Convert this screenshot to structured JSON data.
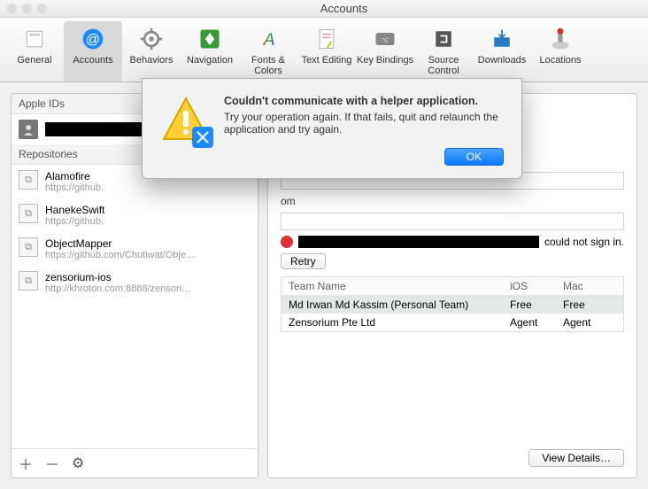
{
  "window": {
    "title": "Accounts"
  },
  "toolbar": {
    "items": [
      {
        "label": "General"
      },
      {
        "label": "Accounts"
      },
      {
        "label": "Behaviors"
      },
      {
        "label": "Navigation"
      },
      {
        "label": "Fonts & Colors"
      },
      {
        "label": "Text Editing"
      },
      {
        "label": "Key Bindings"
      },
      {
        "label": "Source Control"
      },
      {
        "label": "Downloads"
      },
      {
        "label": "Locations"
      }
    ]
  },
  "left": {
    "appleids_header": "Apple IDs",
    "repos_header": "Repositories",
    "repos": [
      {
        "name": "Alamofire",
        "sub": "https://github."
      },
      {
        "name": "HanekeSwift",
        "sub": "https://github."
      },
      {
        "name": "ObjectMapper",
        "sub": "https://github.com/Chutiwat/Obje…"
      },
      {
        "name": "zensorium-ios",
        "sub": "http://khroton.com:8888/zensori…"
      }
    ]
  },
  "right": {
    "field_suffix": "om",
    "error_suffix": " could not sign in.",
    "retry_label": "Retry",
    "table": {
      "headers": {
        "team": "Team Name",
        "ios": "iOS",
        "mac": "Mac"
      },
      "rows": [
        {
          "team": "Md Irwan Md Kassim (Personal Team)",
          "ios": "Free",
          "mac": "Free"
        },
        {
          "team": "Zensorium Pte Ltd",
          "ios": "Agent",
          "mac": "Agent"
        }
      ]
    },
    "view_details": "View Details…"
  },
  "dialog": {
    "title": "Couldn't communicate with a helper application.",
    "msg": "Try your operation again. If that fails, quit and relaunch the application and try again.",
    "ok": "OK"
  }
}
